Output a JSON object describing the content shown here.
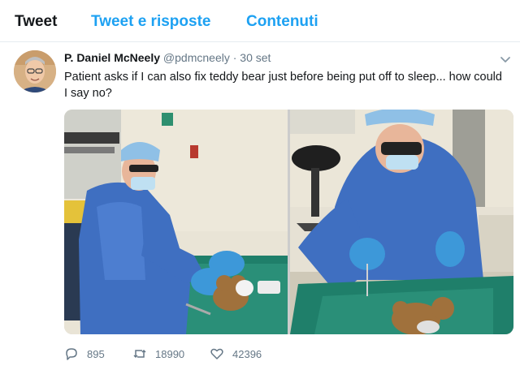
{
  "tabs": [
    {
      "label": "Tweet"
    },
    {
      "label": "Tweet e risposte"
    },
    {
      "label": "Contenuti"
    }
  ],
  "tweet": {
    "author": "P. Daniel McNeely",
    "handle": "@pdmcneely",
    "separator": "·",
    "date": "30 set",
    "text": "Patient asks if I can also fix teddy bear just before being put off to sleep... how could I say no?",
    "stats": {
      "replies": "895",
      "retweets": "18990",
      "likes": "42396"
    }
  },
  "colors": {
    "accent": "#1da1f2",
    "muted": "#657786",
    "text": "#14171a"
  },
  "icons": [
    "reply-icon",
    "retweet-icon",
    "like-icon",
    "chevron-down-icon"
  ]
}
